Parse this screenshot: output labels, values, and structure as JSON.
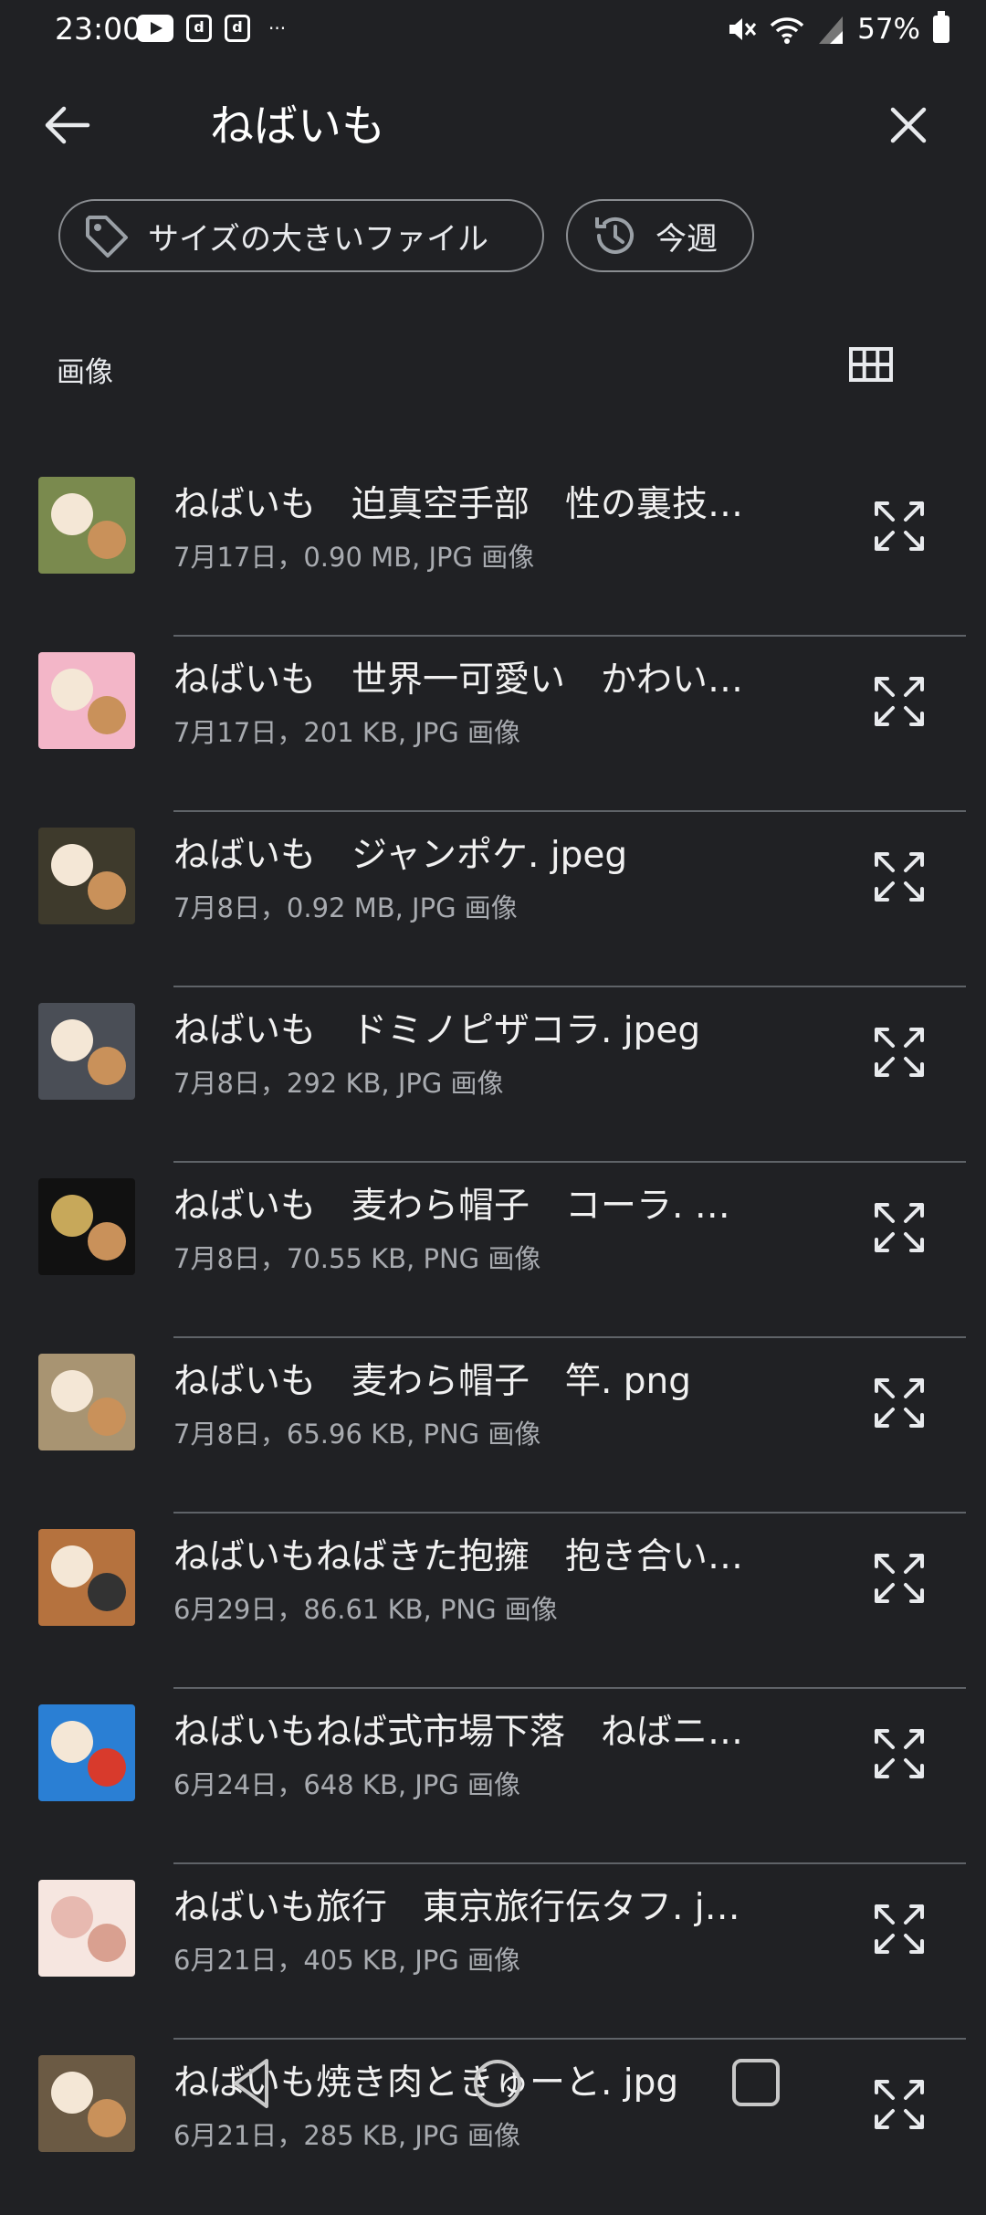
{
  "status_bar": {
    "time": "23:00",
    "battery": "57%",
    "icons": [
      "youtube-icon",
      "d-app-icon",
      "d-app-icon",
      "more-dots-icon",
      "mute-icon",
      "wifi-icon",
      "signal-icon",
      "battery-icon"
    ]
  },
  "header": {
    "query": "ねばいも",
    "back_icon": "arrow-left-icon",
    "close_icon": "close-icon"
  },
  "chips": [
    {
      "label": "サイズの大きいファイル",
      "icon": "tag-icon"
    },
    {
      "label": "今週",
      "icon": "history-icon"
    }
  ],
  "section": {
    "title": "画像",
    "view_toggle_icon": "grid-view-icon"
  },
  "colors": {
    "background": "#202124",
    "text": "#e8eaed",
    "meta_text": "#a8abb0",
    "divider": "#5f6368",
    "chip_border": "#8a8d91"
  },
  "files": [
    {
      "name": "ねばいも　迫真空手部　性の裏技…",
      "meta": "7月17日，0.90 MB, JPG 画像"
    },
    {
      "name": "ねばいも　世界一可愛い　かわい…",
      "meta": "7月17日，201 KB, JPG 画像"
    },
    {
      "name": "ねばいも　ジャンポケ. jpeg",
      "meta": "7月8日，0.92 MB, JPG 画像"
    },
    {
      "name": "ねばいも　ドミノピザコラ. jpeg",
      "meta": "7月8日，292 KB, JPG 画像"
    },
    {
      "name": "ねばいも　麦わら帽子　コーラ. …",
      "meta": "7月8日，70.55 KB, PNG 画像"
    },
    {
      "name": "ねばいも　麦わら帽子　竿. png",
      "meta": "7月8日，65.96 KB, PNG 画像"
    },
    {
      "name": "ねばいもねばきた抱擁　抱き合い…",
      "meta": "6月29日，86.61 KB, PNG 画像"
    },
    {
      "name": "ねばいもねば式市場下落　ねばニ…",
      "meta": "6月24日，648 KB, JPG 画像"
    },
    {
      "name": "ねばいも旅行　東京旅行伝タフ. j…",
      "meta": "6月21日，405 KB, JPG 画像"
    },
    {
      "name": "ねばいも焼き肉ときゅーと. jpg",
      "meta": "6月21日，285 KB, JPG 画像"
    }
  ],
  "navigation": [
    "nav-back-icon",
    "nav-home-icon",
    "nav-recents-icon"
  ]
}
